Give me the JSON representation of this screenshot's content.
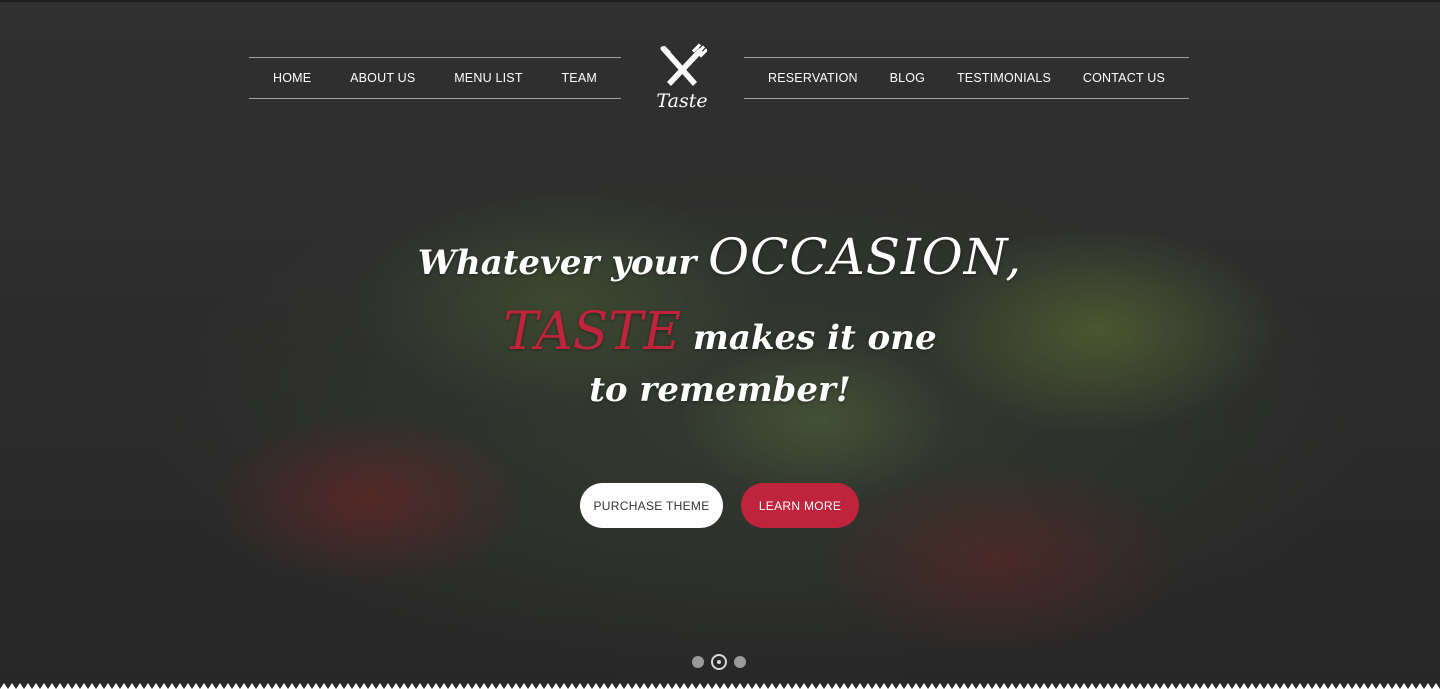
{
  "nav": {
    "left": [
      {
        "label": "HOME"
      },
      {
        "label": "ABOUT US"
      },
      {
        "label": "MENU LIST"
      },
      {
        "label": "TEAM"
      }
    ],
    "right": [
      {
        "label": "RESERVATION"
      },
      {
        "label": "BLOG"
      },
      {
        "label": "TESTIMONIALS"
      },
      {
        "label": "CONTACT US"
      }
    ]
  },
  "logo": {
    "text": "Taste",
    "icon": "crossed-fork-knife-icon"
  },
  "hero": {
    "line1_prefix": "Whatever your",
    "line1_big": "OCCASION,",
    "line2_highlight": "TASTE",
    "line2_rest": "makes it one",
    "line3": "to remember!"
  },
  "buttons": {
    "purchase": "PURCHASE THEME",
    "learn": "LEARN MORE"
  },
  "slider": {
    "count": 3,
    "active_index": 1
  },
  "colors": {
    "accent": "#c0243c",
    "text": "#ffffff"
  }
}
